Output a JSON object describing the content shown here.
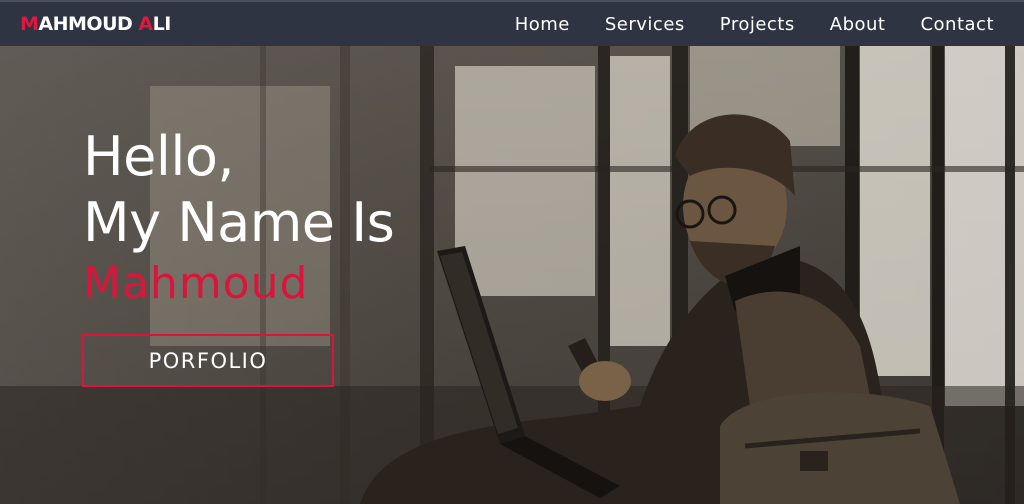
{
  "brand": {
    "first_initial": "M",
    "first_rest": "AHMOUD",
    "last_initial": "A",
    "last_rest": "LI"
  },
  "nav": {
    "items": [
      "Home",
      "Services",
      "Projects",
      "About",
      "Contact"
    ]
  },
  "hero": {
    "line1": "Hello,",
    "line2": "My Name Is",
    "name": "Mahmoud",
    "button_label": "PORFOLIO"
  },
  "colors": {
    "accent": "#dc143c",
    "navbar": "#2e3442",
    "text": "#ffffff"
  }
}
